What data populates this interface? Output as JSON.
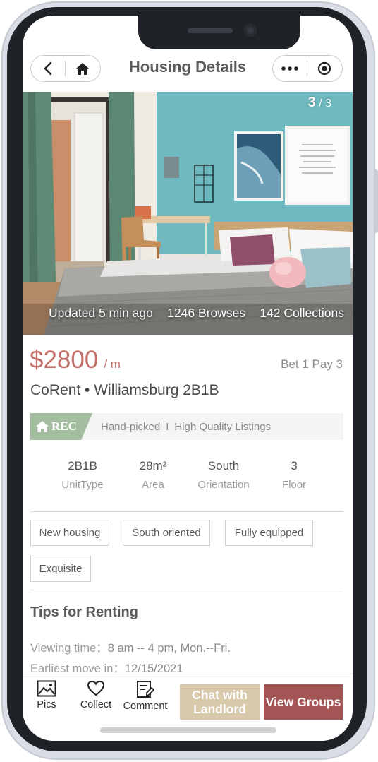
{
  "nav": {
    "title": "Housing Details",
    "back_icon": "chevron-left-icon",
    "home_icon": "home-icon",
    "more_icon": "more-dots-icon",
    "close_icon": "target-circle-icon"
  },
  "photo": {
    "current": "3",
    "separator": "/",
    "total": "3",
    "updated": "Updated 5 min ago",
    "browses": "1246 Browses",
    "collections": "142 Collections"
  },
  "listing": {
    "price": "$2800",
    "per": "/ m",
    "payment": "Bet 1 Pay 3",
    "title": "CoRent • Williamsburg 2B1B"
  },
  "rec": {
    "badge": "REC",
    "tagline_left": "Hand-picked",
    "tagline_sep": "I",
    "tagline_right": "High Quality Listings"
  },
  "specs": [
    {
      "value": "2B1B",
      "label": "UnitType"
    },
    {
      "value": "28m²",
      "label": "Area"
    },
    {
      "value": "South",
      "label": "Orientation"
    },
    {
      "value": "3",
      "label": "Floor"
    }
  ],
  "tags": [
    "New housing",
    "South oriented",
    "Fully equipped",
    "Exquisite"
  ],
  "tips": {
    "title": "Tips for Renting",
    "viewing_label": "Viewing time：",
    "viewing_value": "8 am -- 4 pm, Mon.--Fri.",
    "move_label": "Earliest move in：",
    "move_value": "12/15/2021"
  },
  "bottom": {
    "pics": "Pics",
    "collect": "Collect",
    "comment": "Comment",
    "chat": "Chat with Landlord",
    "groups": "View Groups"
  },
  "colors": {
    "price": "#c4706a",
    "rec_badge": "#a4bca0",
    "chat_button": "#d8c9aa",
    "groups_button": "#a35555"
  }
}
